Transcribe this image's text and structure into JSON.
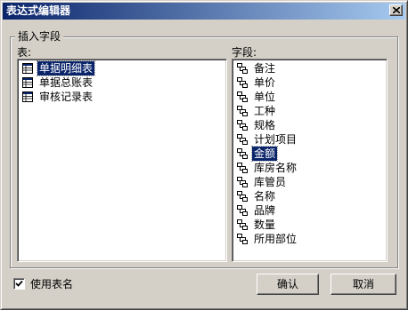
{
  "window": {
    "title": "表达式编辑器"
  },
  "group": {
    "legend": "插入字段"
  },
  "tables": {
    "label": "表:",
    "items": [
      {
        "label": "单据明细表",
        "selected": true
      },
      {
        "label": "单据总账表",
        "selected": false
      },
      {
        "label": "审核记录表",
        "selected": false
      }
    ]
  },
  "fields": {
    "label": "字段:",
    "items": [
      {
        "label": "备注",
        "selected": false
      },
      {
        "label": "单价",
        "selected": false
      },
      {
        "label": "单位",
        "selected": false
      },
      {
        "label": "工种",
        "selected": false
      },
      {
        "label": "规格",
        "selected": false
      },
      {
        "label": "计划项目",
        "selected": false
      },
      {
        "label": "金额",
        "selected": true
      },
      {
        "label": "库房名称",
        "selected": false
      },
      {
        "label": "库管员",
        "selected": false
      },
      {
        "label": "名称",
        "selected": false
      },
      {
        "label": "品牌",
        "selected": false
      },
      {
        "label": "数量",
        "selected": false
      },
      {
        "label": "所用部位",
        "selected": false
      }
    ]
  },
  "use_table_name": {
    "label": "使用表名",
    "checked": true
  },
  "buttons": {
    "ok": "确认",
    "cancel": "取消"
  },
  "icons": {
    "close": "close-icon",
    "table": "table-icon",
    "field": "field-icon",
    "check": "checkmark-icon"
  },
  "colors": {
    "titlebar_start": "#0a246a",
    "titlebar_end": "#a6caf0",
    "selection": "#0a246a",
    "face": "#d4d0c8"
  }
}
